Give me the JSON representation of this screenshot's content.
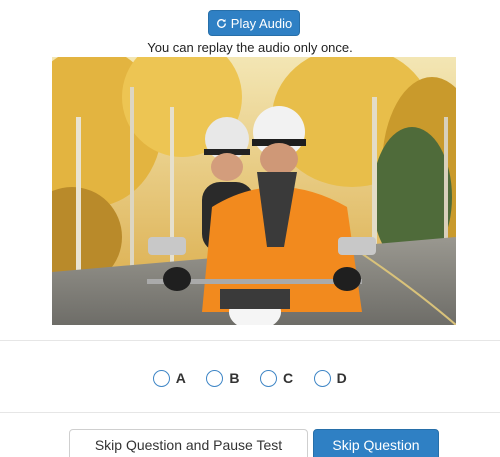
{
  "audio": {
    "play_label": "Play Audio",
    "play_icon": "refresh-icon",
    "note": "You can replay the audio only once."
  },
  "question_image": {
    "icon": "photo-two-people-on-motorcycle"
  },
  "options": [
    {
      "label": "A"
    },
    {
      "label": "B"
    },
    {
      "label": "C"
    },
    {
      "label": "D"
    }
  ],
  "actions": {
    "skip_pause_label": "Skip Question and Pause Test",
    "skip_label": "Skip Question"
  },
  "colors": {
    "primary": "#2f80c4",
    "radio_border": "#3f86c6"
  }
}
